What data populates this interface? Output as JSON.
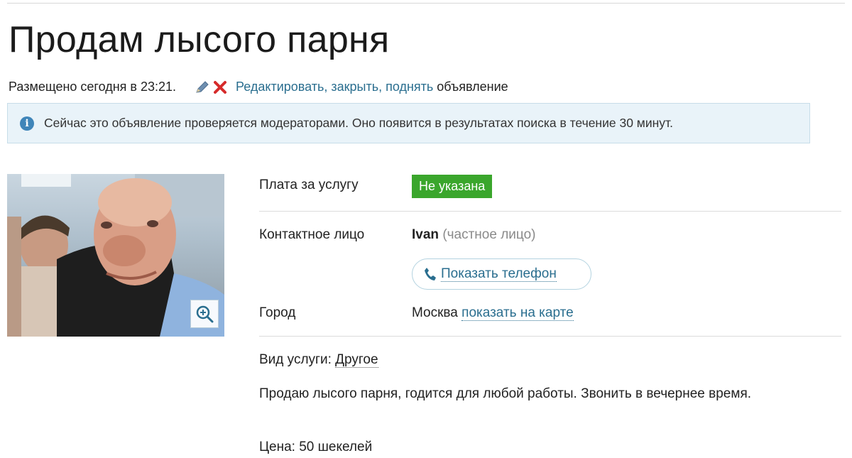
{
  "listing": {
    "title": "Продам лысого парня",
    "posted": "Размещено сегодня в 23:21.",
    "actions_links": "Редактировать, закрыть, поднять",
    "actions_suffix": "объявление"
  },
  "notice": {
    "icon": "info-icon",
    "text": "Сейчас это объявление проверяется модераторами. Оно появится в результатах поиска в течение 30 минут."
  },
  "details": {
    "price_label": "Плата за услугу",
    "price_value": "Не указана",
    "contact_label": "Контактное лицо",
    "contact_name": "Ivan",
    "contact_note": "(частное лицо)",
    "phone_button": "Показать телефон",
    "city_label": "Город",
    "city_value": "Москва",
    "map_link": "показать на карте",
    "service_label": "Вид услуги:",
    "service_value": "Другое",
    "description": "Продаю лысого парня, годится для любой работы. Звонить в вечернее время.",
    "price_line": "Цена: 50 шекелей"
  },
  "colors": {
    "link": "#2a6e8f",
    "badge": "#3aa62c",
    "notice_bg": "#e9f3f9",
    "info_icon": "#3f85b9"
  }
}
